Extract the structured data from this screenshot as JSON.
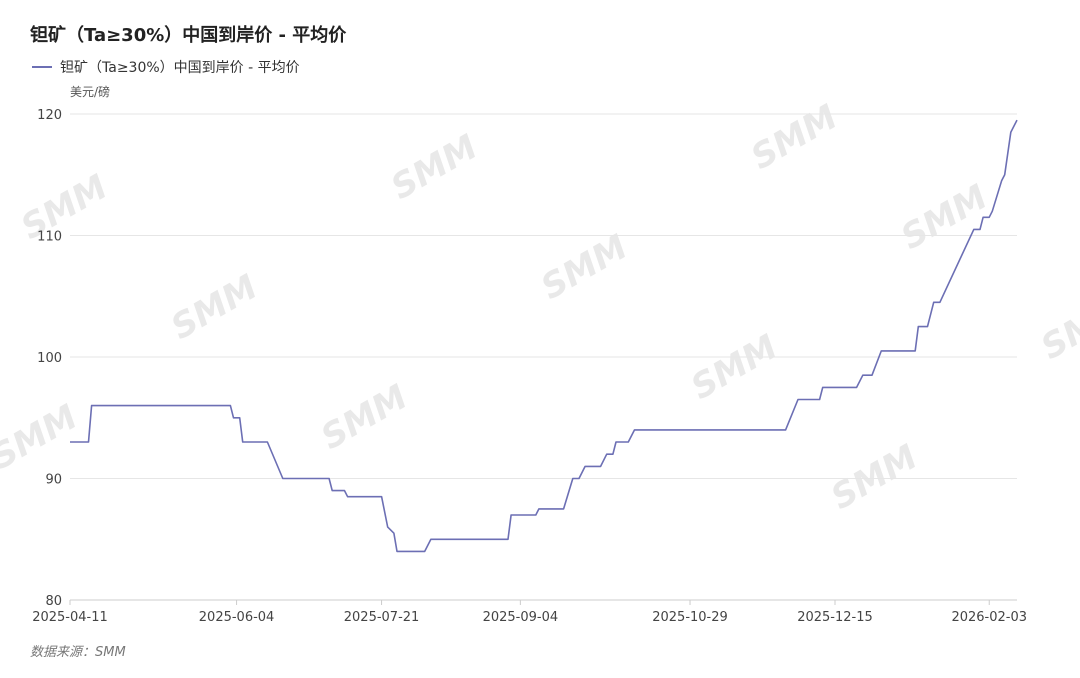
{
  "chart_data": {
    "type": "line",
    "title": "钽矿（Ta≥30%）中国到岸价 - 平均价",
    "ylabel": "美元/磅",
    "ylim": [
      80,
      120
    ],
    "yticks": [
      80,
      90,
      100,
      110,
      120
    ],
    "x_tick_labels": [
      "2025-04-11",
      "2025-06-04",
      "2025-07-21",
      "2025-09-04",
      "2025-10-29",
      "2025-12-15",
      "2026-02-03"
    ],
    "grid": true,
    "legend": "top-left",
    "source": "数据来源：SMM",
    "watermark": "SMM",
    "color": "#6c6fb4",
    "series": [
      {
        "name": "钽矿（Ta≥30%）中国到岸价 - 平均价",
        "points": [
          [
            "2025-04-11",
            93
          ],
          [
            "2025-04-17",
            93
          ],
          [
            "2025-04-18",
            96
          ],
          [
            "2025-06-02",
            96
          ],
          [
            "2025-06-03",
            95
          ],
          [
            "2025-06-05",
            95
          ],
          [
            "2025-06-06",
            93
          ],
          [
            "2025-06-14",
            93
          ],
          [
            "2025-06-19",
            90
          ],
          [
            "2025-07-04",
            90
          ],
          [
            "2025-07-05",
            89
          ],
          [
            "2025-07-09",
            89
          ],
          [
            "2025-07-10",
            88.5
          ],
          [
            "2025-07-21",
            88.5
          ],
          [
            "2025-07-23",
            86
          ],
          [
            "2025-07-25",
            85.5
          ],
          [
            "2025-07-26",
            84
          ],
          [
            "2025-08-04",
            84
          ],
          [
            "2025-08-06",
            85
          ],
          [
            "2025-08-31",
            85
          ],
          [
            "2025-09-01",
            87
          ],
          [
            "2025-09-09",
            87
          ],
          [
            "2025-09-10",
            87.5
          ],
          [
            "2025-09-18",
            87.5
          ],
          [
            "2025-09-21",
            90
          ],
          [
            "2025-09-23",
            90
          ],
          [
            "2025-09-25",
            91
          ],
          [
            "2025-09-30",
            91
          ],
          [
            "2025-10-02",
            92
          ],
          [
            "2025-10-04",
            92
          ],
          [
            "2025-10-05",
            93
          ],
          [
            "2025-10-09",
            93
          ],
          [
            "2025-10-11",
            94
          ],
          [
            "2025-11-29",
            94
          ],
          [
            "2025-12-03",
            96.5
          ],
          [
            "2025-12-10",
            96.5
          ],
          [
            "2025-12-11",
            97.5
          ],
          [
            "2025-12-22",
            97.5
          ],
          [
            "2025-12-24",
            98.5
          ],
          [
            "2025-12-27",
            98.5
          ],
          [
            "2025-12-30",
            100.5
          ],
          [
            "2026-01-10",
            100.5
          ],
          [
            "2026-01-11",
            102.5
          ],
          [
            "2026-01-14",
            102.5
          ],
          [
            "2026-01-16",
            104.5
          ],
          [
            "2026-01-18",
            104.5
          ],
          [
            "2026-01-29",
            110.5
          ],
          [
            "2026-01-31",
            110.5
          ],
          [
            "2026-02-01",
            111.5
          ],
          [
            "2026-02-03",
            111.5
          ],
          [
            "2026-02-04",
            112
          ],
          [
            "2026-02-07",
            114.5
          ],
          [
            "2026-02-08",
            115
          ],
          [
            "2026-02-10",
            118.5
          ],
          [
            "2026-02-12",
            119.5
          ]
        ]
      }
    ]
  }
}
